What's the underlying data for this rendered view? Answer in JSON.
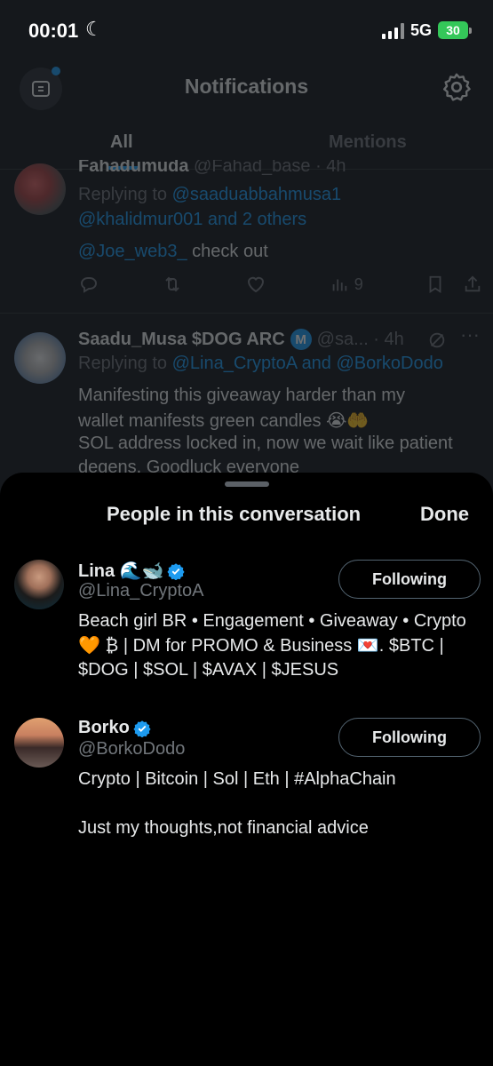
{
  "status_bar": {
    "time": "00:01",
    "moon_glyph": "☾",
    "network": "5G",
    "battery": "30"
  },
  "header": {
    "title": "Notifications",
    "tabs": [
      {
        "label": "All",
        "active": true
      },
      {
        "label": "Mentions",
        "active": false
      }
    ]
  },
  "feed": [
    {
      "author_partial": "Fahadumuda",
      "handle_partial": "@Fahad_base · 4h",
      "replying_label": "Replying to",
      "replying_to_line1": "@saaduabbahmusa1",
      "replying_to_line2": "@khalidmur001 and 2 others",
      "mention": "@Joe_web3_",
      "text": " check out",
      "views": "9"
    },
    {
      "author": "Saadu_Musa $DOG ARC",
      "badge": "M",
      "handle_time": "@sa... · 4h",
      "replying_label": "Replying to",
      "replying_to": "@Lina_CryptoA and @BorkoDodo",
      "text_line1": "Manifesting this giveaway harder than my",
      "text_line2": "wallet manifests green candles 😭🤲",
      "text_line3": "SOL address locked in, now we wait like patient",
      "text_line4": "degens. Goodluck everyone"
    }
  ],
  "sheet": {
    "title": "People in this conversation",
    "done_label": "Done",
    "people": [
      {
        "name": "Lina 🌊🐋",
        "handle": "@Lina_CryptoA",
        "button": "Following",
        "bio": "Beach girl BR • Engagement • Giveaway • Crypto\n🧡 ₿ | DM for PROMO & Business 💌. $BTC |\n$DOG | $SOL | $AVAX | $JESUS"
      },
      {
        "name": "Borko",
        "handle": "@BorkoDodo",
        "button": "Following",
        "bio": "Crypto | Bitcoin | Sol | Eth | #AlphaChain\n\nJust my thoughts,not financial advice"
      }
    ]
  },
  "colors": {
    "accent": "#1d9bf0",
    "muted": "#71767b",
    "battery": "#34c759"
  },
  "icons": [
    "moon-icon",
    "signal-icon",
    "battery-icon",
    "profile-switch-icon",
    "gear-icon",
    "reply-icon",
    "retweet-icon",
    "like-icon",
    "views-icon",
    "bookmark-icon",
    "share-icon",
    "grok-icon",
    "more-icon",
    "verified-badge-icon"
  ]
}
